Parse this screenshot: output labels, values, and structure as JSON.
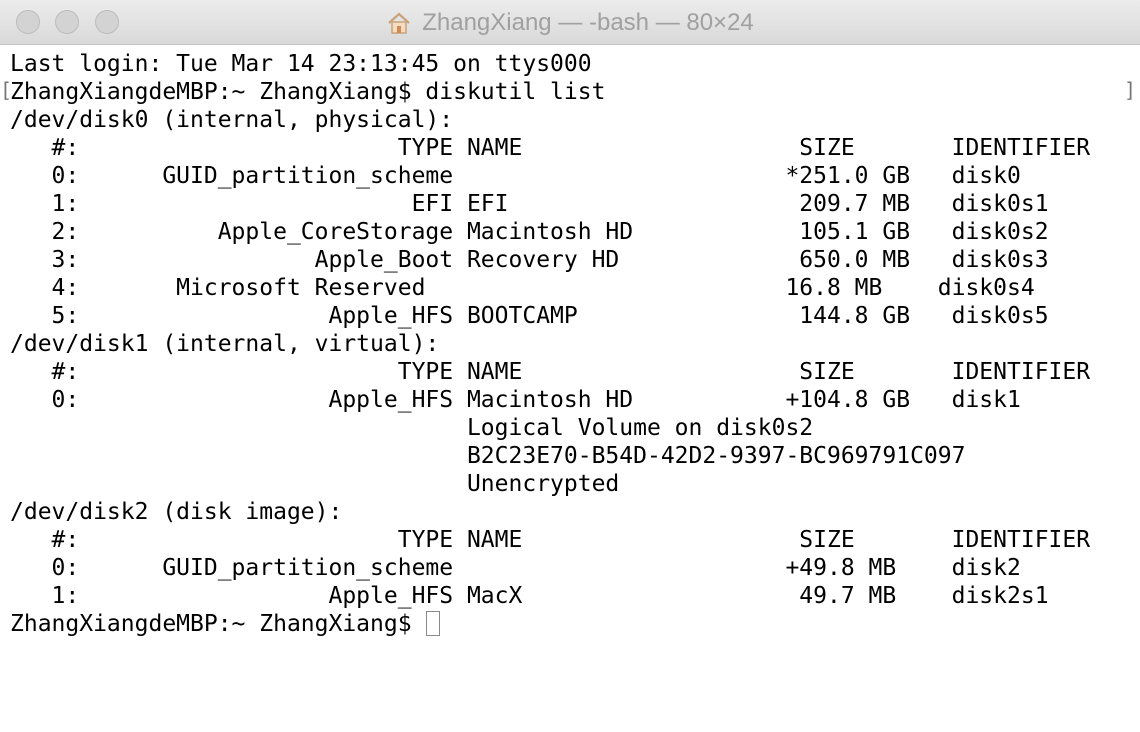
{
  "window": {
    "title": "ZhangXiang — -bash — 80×24",
    "title_icon": "home-icon"
  },
  "terminal": {
    "lines": [
      "Last login: Tue Mar 14 23:13:45 on ttys000",
      "ZhangXiangdeMBP:~ ZhangXiang$ diskutil list",
      "/dev/disk0 (internal, physical):",
      "   #:                       TYPE NAME                    SIZE       IDENTIFIER",
      "   0:      GUID_partition_scheme                        *251.0 GB   disk0",
      "   1:                        EFI EFI                     209.7 MB   disk0s1",
      "   2:          Apple_CoreStorage Macintosh HD            105.1 GB   disk0s2",
      "   3:                 Apple_Boot Recovery HD             650.0 MB   disk0s3",
      "   4:       Microsoft Reserved                          16.8 MB    disk0s4",
      "   5:                  Apple_HFS BOOTCAMP                144.8 GB   disk0s5",
      "/dev/disk1 (internal, virtual):",
      "   #:                       TYPE NAME                    SIZE       IDENTIFIER",
      "   0:                  Apple_HFS Macintosh HD           +104.8 GB   disk1",
      "                                 Logical Volume on disk0s2",
      "                                 B2C23E70-B54D-42D2-9397-BC969791C097",
      "                                 Unencrypted",
      "/dev/disk2 (disk image):",
      "   #:                       TYPE NAME                    SIZE       IDENTIFIER",
      "   0:      GUID_partition_scheme                        +49.8 MB    disk2",
      "   1:                  Apple_HFS MacX                    49.7 MB    disk2s1"
    ],
    "prompt": "ZhangXiangdeMBP:~ ZhangXiang$ "
  }
}
